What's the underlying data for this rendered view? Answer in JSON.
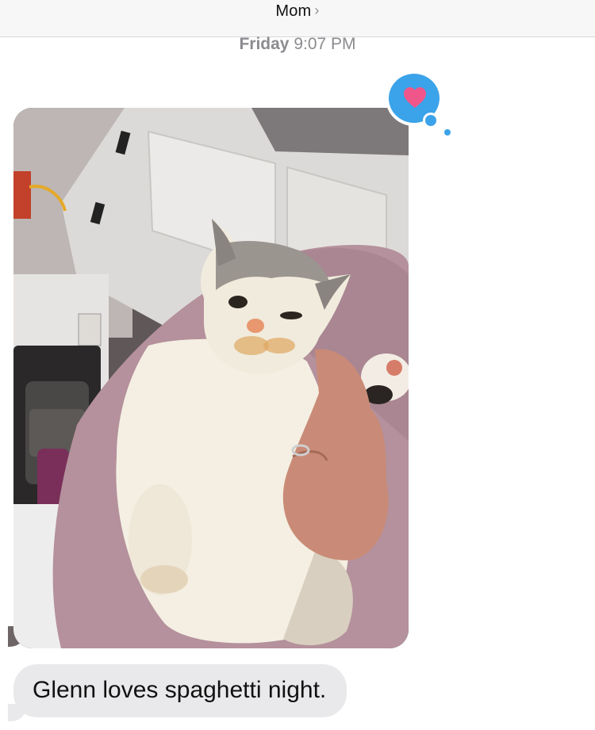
{
  "header": {
    "contact_name": "Mom",
    "chevron_icon": "chevron-right-icon"
  },
  "thread": {
    "timestamp_day": "Friday",
    "timestamp_time": "9:07 PM"
  },
  "messages": [
    {
      "type": "image",
      "sender": "incoming",
      "description_icon": "cat-photo",
      "reaction": {
        "icon": "heart-icon",
        "bubble_color": "#3ba3e9",
        "heart_color": "#f0568a"
      }
    },
    {
      "type": "text",
      "sender": "incoming",
      "text": "Glenn loves spaghetti night."
    }
  ],
  "colors": {
    "header_bg": "#f7f7f8",
    "incoming_bubble": "#e9e9eb",
    "timestamp": "#8b8b90"
  }
}
